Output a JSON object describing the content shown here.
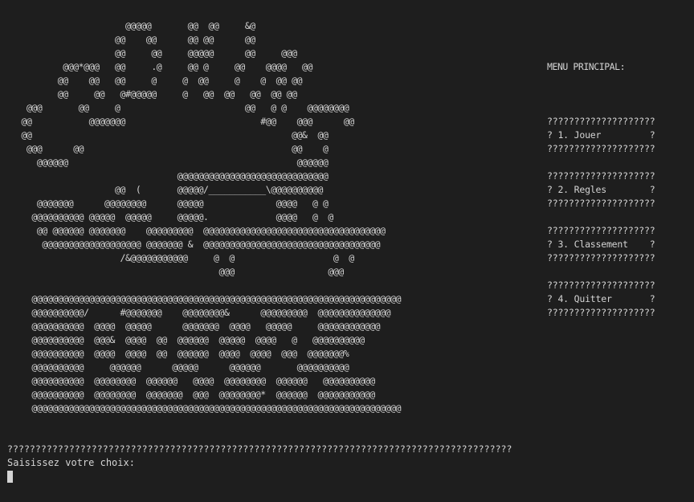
{
  "terminal": {
    "ascii_art": "                     @@@@@       @@  @@     &@\n                   @@    @@      @@ @@      @@\n                   @@     @@     @@@@@      @@     @@@\n         @@@*@@@   @@     .@     @@ @     @@    @@@@   @@\n        @@    @@   @@     @     @  @@     @    @  @@ @@\n        @@     @@   @#@@@@@     @   @@  @@   @@  @@ @@\n  @@@       @@     @                        @@   @ @    @@@@@@@@\n @@           @@@@@@@                          #@@    @@@      @@\n @@                                                  @@&  @@\n  @@@      @@                                        @@    @\n    @@@@@@                                            @@@@@@\n                               @@@@@@@@@@@@@@@@@@@@@@@@@@@@@\n                   @@  (       @@@@@/___________\\@@@@@@@@@@\n    @@@@@@@      @@@@@@@@      @@@@@              @@@@   @ @\n   @@@@@@@@@@ @@@@@  @@@@@     @@@@@.             @@@@   @  @\n    @@ @@@@@@ @@@@@@@    @@@@@@@@@  @@@@@@@@@@@@@@@@@@@@@@@@@@@@@@@@@@@\n     @@@@@@@@@@@@@@@@@@@ @@@@@@@ &  @@@@@@@@@@@@@@@@@@@@@@@@@@@@@@@@@@\n                    /&@@@@@@@@@@@     @  @                   @  @\n                                       @@@                  @@@\n\n   @@@@@@@@@@@@@@@@@@@@@@@@@@@@@@@@@@@@@@@@@@@@@@@@@@@@@@@@@@@@@@@@@@@@@@@\n   @@@@@@@@@@/      #@@@@@@@    @@@@@@@@&      @@@@@@@@@  @@@@@@@@@@@@@@\n   @@@@@@@@@@  @@@@  @@@@@      @@@@@@@  @@@@   @@@@@     @@@@@@@@@@@@\n   @@@@@@@@@@  @@@&  @@@@  @@  @@@@@@  @@@@@  @@@@   @   @@@@@@@@@@\n   @@@@@@@@@@  @@@@  @@@@  @@  @@@@@@  @@@@  @@@@  @@@  @@@@@@@%\n   @@@@@@@@@@     @@@@@@      @@@@@      @@@@@@       @@@@@@@@@@\n   @@@@@@@@@@  @@@@@@@@  @@@@@@   @@@@  @@@@@@@@  @@@@@@   @@@@@@@@@@\n   @@@@@@@@@@  @@@@@@@@  @@@@@@@  @@@  @@@@@@@@*  @@@@@@  @@@@@@@@@@@\n   @@@@@@@@@@@@@@@@@@@@@@@@@@@@@@@@@@@@@@@@@@@@@@@@@@@@@@@@@@@@@@@@@@@@@@@",
    "separator": "??????????????????????????????????????????????????????????????????????????????????????????",
    "prompt": "Saisissez votre choix:"
  },
  "menu": {
    "title": "MENU PRINCIPAL:",
    "items": [
      {
        "top": "????????????????????",
        "label": "? 1. Jouer         ?",
        "bottom": "????????????????????"
      },
      {
        "top": "????????????????????",
        "label": "? 2. Regles        ?",
        "bottom": "????????????????????"
      },
      {
        "top": "????????????????????",
        "label": "? 3. Classement    ?",
        "bottom": "????????????????????"
      },
      {
        "top": "????????????????????",
        "label": "? 4. Quitter       ?",
        "bottom": "????????????????????"
      }
    ]
  },
  "colors": {
    "background": "#1e1e1e",
    "text": "#d4d4d4"
  }
}
